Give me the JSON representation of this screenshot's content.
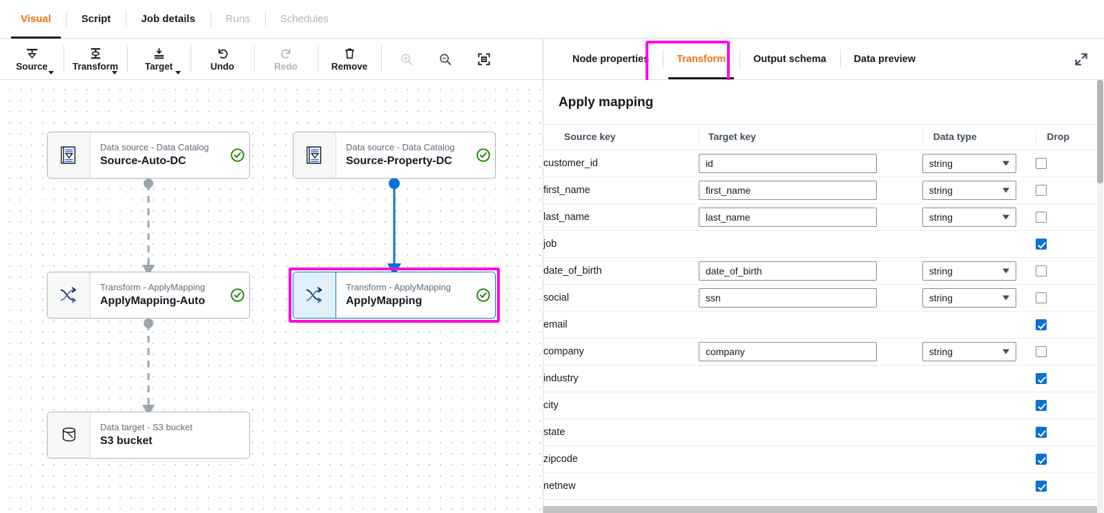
{
  "top_tabs": [
    {
      "label": "Visual",
      "state": "active"
    },
    {
      "label": "Script",
      "state": "normal"
    },
    {
      "label": "Job details",
      "state": "normal"
    },
    {
      "label": "Runs",
      "state": "disabled"
    },
    {
      "label": "Schedules",
      "state": "disabled"
    }
  ],
  "toolbar": {
    "buttons": [
      {
        "label": "Source",
        "icon": "source-icon",
        "has_caret": true,
        "disabled": false
      },
      {
        "label": "Transform",
        "icon": "transform-icon",
        "has_caret": true,
        "disabled": false
      },
      {
        "label": "Target",
        "icon": "target-icon",
        "has_caret": true,
        "disabled": false
      },
      {
        "label": "Undo",
        "icon": "undo-icon",
        "has_caret": false,
        "disabled": false
      },
      {
        "label": "Redo",
        "icon": "redo-icon",
        "has_caret": false,
        "disabled": true
      },
      {
        "label": "Remove",
        "icon": "trash-icon",
        "has_caret": false,
        "disabled": false
      }
    ],
    "zoom_in": "zoom-in-icon",
    "zoom_out": "zoom-out-icon",
    "fit_view": "fit-to-screen-icon"
  },
  "canvas": {
    "nodes": [
      {
        "id": "source-auto-dc",
        "subtitle": "Data source - Data Catalog",
        "title": "Source-Auto-DC",
        "icon": "data-catalog-icon",
        "status": "valid",
        "selected": false
      },
      {
        "id": "source-property-dc",
        "subtitle": "Data source - Data Catalog",
        "title": "Source-Property-DC",
        "icon": "data-catalog-icon",
        "status": "valid",
        "selected": false
      },
      {
        "id": "applymapping-auto",
        "subtitle": "Transform - ApplyMapping",
        "title": "ApplyMapping-Auto",
        "icon": "apply-mapping-icon",
        "status": "valid",
        "selected": false
      },
      {
        "id": "applymapping",
        "subtitle": "Transform - ApplyMapping",
        "title": "ApplyMapping",
        "icon": "apply-mapping-icon",
        "status": "valid",
        "selected": true
      },
      {
        "id": "s3-bucket",
        "subtitle": "Data target - S3 bucket",
        "title": "S3 bucket",
        "icon": "s3-bucket-icon",
        "status": "none",
        "selected": false
      }
    ],
    "edge_colors": {
      "inactive": "#9ba5ad",
      "active": "#0972d3"
    }
  },
  "panel": {
    "tabs": [
      {
        "label": "Node properties",
        "state": "normal"
      },
      {
        "label": "Transform",
        "state": "active"
      },
      {
        "label": "Output schema",
        "state": "normal"
      },
      {
        "label": "Data preview",
        "state": "normal"
      }
    ],
    "expand_icon": "expand-icon",
    "title": "Apply mapping",
    "columns": [
      "Source key",
      "Target key",
      "Data type",
      "Drop"
    ],
    "rows": [
      {
        "source_key": "customer_id",
        "target_key": "id",
        "data_type": "string",
        "drop": false,
        "has_fields": true
      },
      {
        "source_key": "first_name",
        "target_key": "first_name",
        "data_type": "string",
        "drop": false,
        "has_fields": true
      },
      {
        "source_key": "last_name",
        "target_key": "last_name",
        "data_type": "string",
        "drop": false,
        "has_fields": true
      },
      {
        "source_key": "job",
        "target_key": "",
        "data_type": "",
        "drop": true,
        "has_fields": false
      },
      {
        "source_key": "date_of_birth",
        "target_key": "date_of_birth",
        "data_type": "string",
        "drop": false,
        "has_fields": true
      },
      {
        "source_key": "social",
        "target_key": "ssn",
        "data_type": "string",
        "drop": false,
        "has_fields": true
      },
      {
        "source_key": "email",
        "target_key": "",
        "data_type": "",
        "drop": true,
        "has_fields": false
      },
      {
        "source_key": "company",
        "target_key": "company",
        "data_type": "string",
        "drop": false,
        "has_fields": true
      },
      {
        "source_key": "industry",
        "target_key": "",
        "data_type": "",
        "drop": true,
        "has_fields": false
      },
      {
        "source_key": "city",
        "target_key": "",
        "data_type": "",
        "drop": true,
        "has_fields": false
      },
      {
        "source_key": "state",
        "target_key": "",
        "data_type": "",
        "drop": true,
        "has_fields": false
      },
      {
        "source_key": "zipcode",
        "target_key": "",
        "data_type": "",
        "drop": true,
        "has_fields": false
      },
      {
        "source_key": "netnew",
        "target_key": "",
        "data_type": "",
        "drop": true,
        "has_fields": false
      }
    ]
  },
  "colors": {
    "accent_orange": "#ec7211",
    "highlight_magenta": "#ff00e0",
    "link_blue": "#0972d3",
    "status_green": "#1d8102"
  }
}
